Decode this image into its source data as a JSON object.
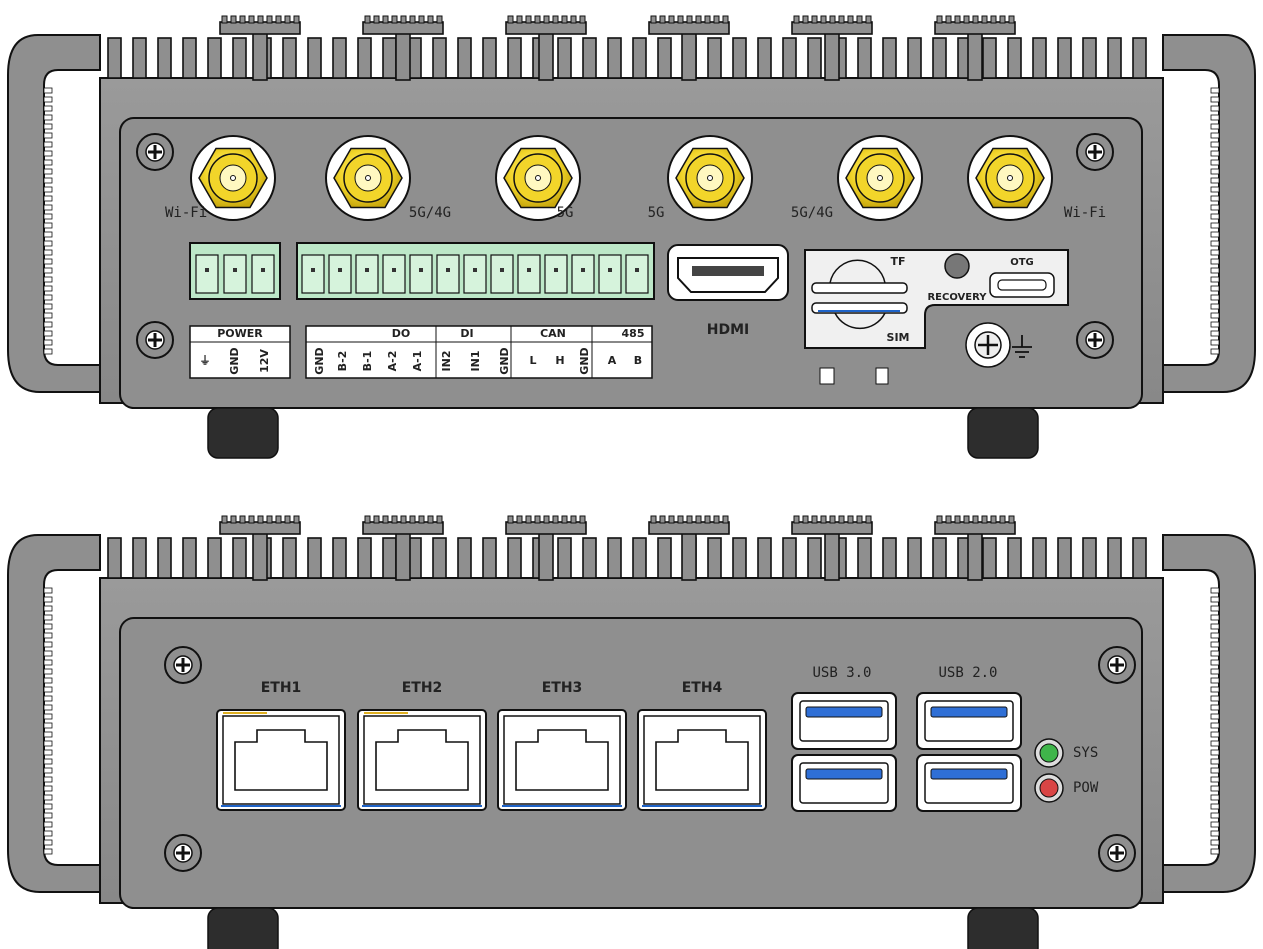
{
  "colors": {
    "case": "#8f8f8f",
    "case_dark": "#7c7c7c",
    "outline": "#111111",
    "antenna_gold": "#f2d52a",
    "terminal_green": "#bde8c8",
    "usb3_blue": "#2f6fd6",
    "foot": "#2d2d2d",
    "led_sys": "#3fb54a",
    "led_pow": "#d94545",
    "panel_white": "#f5f5f5"
  },
  "top_view": {
    "antennas": [
      {
        "label": "Wi-Fi",
        "icon": "sma-antenna-icon"
      },
      {
        "label": "5G/4G",
        "icon": "sma-antenna-icon"
      },
      {
        "label": "5G",
        "icon": "sma-antenna-icon"
      },
      {
        "label": "5G",
        "icon": "sma-antenna-icon"
      },
      {
        "label": "5G/4G",
        "icon": "sma-antenna-icon"
      },
      {
        "label": "Wi-Fi",
        "icon": "sma-antenna-icon"
      }
    ],
    "power_block": {
      "header": "POWER",
      "pins": [
        "⏚",
        "GND",
        "12V"
      ]
    },
    "io_block": {
      "groups": [
        {
          "header": "DO",
          "pins": [
            "GND",
            "B-2",
            "B-1",
            "A-2",
            "A-1"
          ]
        },
        {
          "header": "DI",
          "pins": [
            "IN2",
            "IN1"
          ]
        },
        {
          "header": "CAN",
          "pins": [
            "GND",
            "L",
            "H"
          ]
        },
        {
          "header": "485",
          "pins": [
            "GND",
            "A",
            "B"
          ]
        }
      ]
    },
    "hdmi_label": "HDMI",
    "card_slots": {
      "tf_label": "TF",
      "sim_label": "SIM",
      "recovery_label": "RECOVERY",
      "otg_label": "OTG"
    },
    "ground_icon": "ground-icon"
  },
  "bottom_view": {
    "eth_ports": [
      "ETH1",
      "ETH2",
      "ETH3",
      "ETH4"
    ],
    "usb3_label": "USB 3.0",
    "usb2_label": "USB 2.0",
    "leds": [
      {
        "label": "SYS",
        "color": "#3fb54a"
      },
      {
        "label": "POW",
        "color": "#d94545"
      }
    ]
  }
}
